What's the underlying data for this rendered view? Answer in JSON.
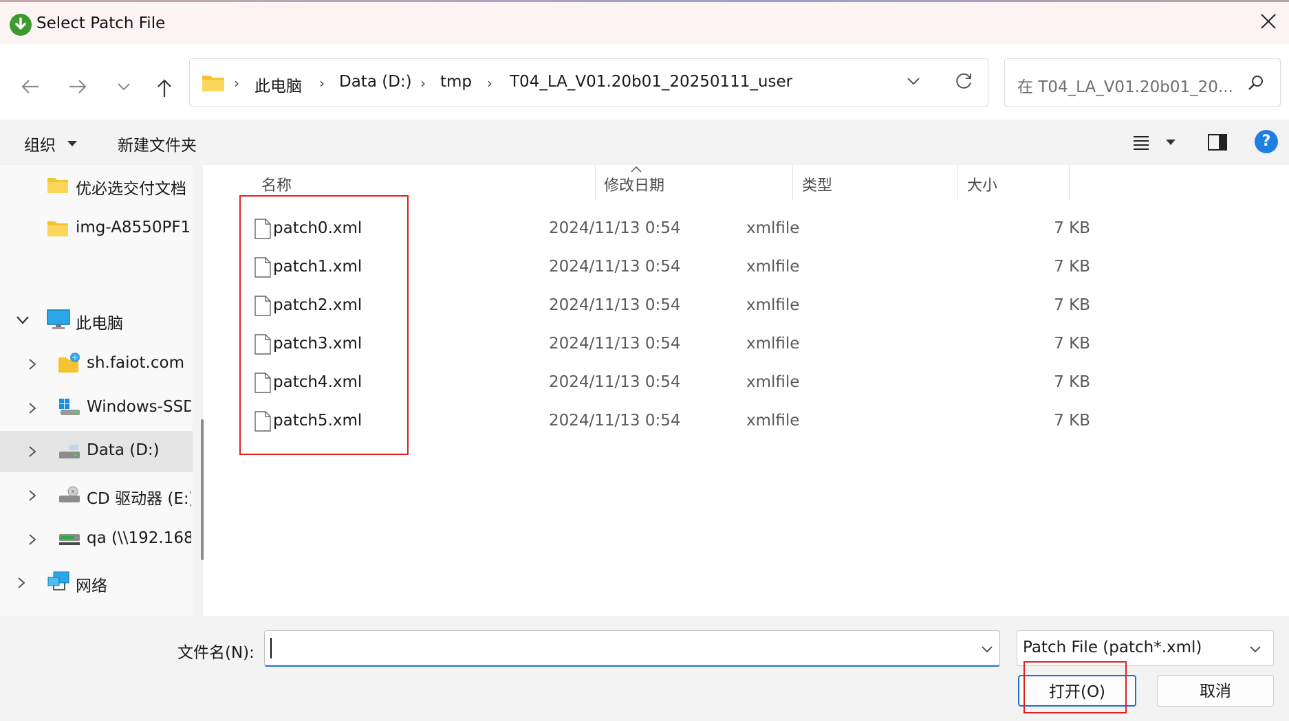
{
  "window": {
    "title": "Select Patch File"
  },
  "nav": {
    "breadcrumbs": [
      "此电脑",
      "Data (D:)",
      "tmp",
      "T04_LA_V01.20b01_20250111_user"
    ],
    "search_placeholder": "在 T04_LA_V01.20b01_20..."
  },
  "toolbar": {
    "organize": "组织",
    "new_folder": "新建文件夹"
  },
  "sidebar": {
    "items": [
      {
        "label": "优必选交付文档",
        "icon": "folder-icon"
      },
      {
        "label": "img-A8550PF1",
        "icon": "folder-icon"
      },
      {
        "label": "此电脑",
        "icon": "computer-icon"
      },
      {
        "label": "sh.faiot.com",
        "icon": "network-folder-icon"
      },
      {
        "label": "Windows-SSD",
        "icon": "windows-drive-icon"
      },
      {
        "label": "Data (D:)",
        "icon": "drive-icon"
      },
      {
        "label": "CD 驱动器 (E:)",
        "icon": "cd-drive-icon"
      },
      {
        "label": "qa (\\\\192.168",
        "icon": "network-drive-icon"
      },
      {
        "label": "网络",
        "icon": "network-icon"
      }
    ]
  },
  "columns": {
    "name": "名称",
    "modified": "修改日期",
    "type": "类型",
    "size": "大小"
  },
  "files": [
    {
      "name": "patch0.xml",
      "modified": "2024/11/13 0:54",
      "type": "xmlfile",
      "size": "7 KB"
    },
    {
      "name": "patch1.xml",
      "modified": "2024/11/13 0:54",
      "type": "xmlfile",
      "size": "7 KB"
    },
    {
      "name": "patch2.xml",
      "modified": "2024/11/13 0:54",
      "type": "xmlfile",
      "size": "7 KB"
    },
    {
      "name": "patch3.xml",
      "modified": "2024/11/13 0:54",
      "type": "xmlfile",
      "size": "7 KB"
    },
    {
      "name": "patch4.xml",
      "modified": "2024/11/13 0:54",
      "type": "xmlfile",
      "size": "7 KB"
    },
    {
      "name": "patch5.xml",
      "modified": "2024/11/13 0:54",
      "type": "xmlfile",
      "size": "7 KB"
    }
  ],
  "footer": {
    "filename_label": "文件名(N):",
    "filename_value": "",
    "filetype_selected": "Patch File (patch*.xml)",
    "open_label": "打开(O)",
    "cancel_label": "取消"
  },
  "colors": {
    "accent": "#1f6fd0",
    "highlight_box": "#e02020",
    "folder": "#f4c430"
  }
}
